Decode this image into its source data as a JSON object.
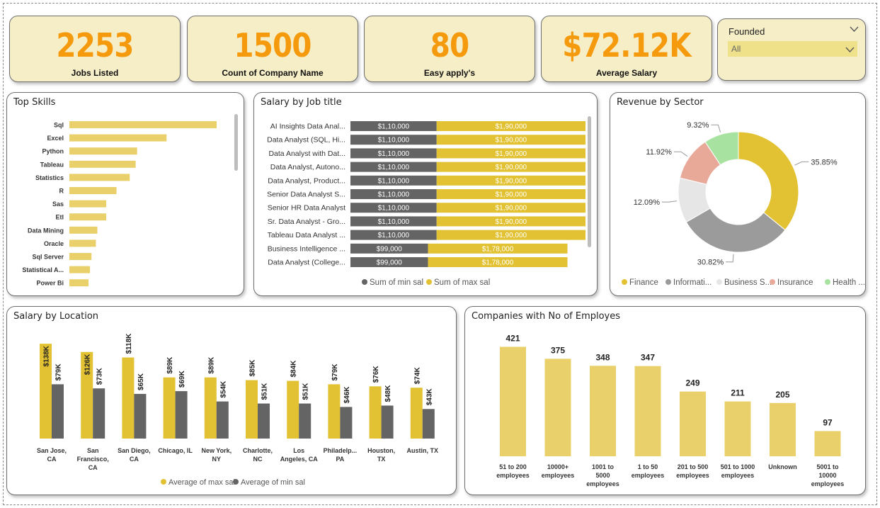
{
  "kpis": [
    {
      "value": "2253",
      "label": "Jobs Listed"
    },
    {
      "value": "1500",
      "label": "Count of Company Name"
    },
    {
      "value": "80",
      "label": "Easy apply's"
    },
    {
      "value": "$72.12K",
      "label": "Average Salary"
    }
  ],
  "slicer": {
    "title": "Founded",
    "selected": "All"
  },
  "colors": {
    "gold": "#e2c232",
    "gold_light": "#ead06a",
    "dark_grey": "#646464",
    "kpi_orange": "#f59a0c",
    "kpi_bg": "#f6eec7"
  },
  "top_skills": {
    "title": "Top Skills",
    "chart_data": {
      "type": "bar",
      "orientation": "horizontal",
      "categories": [
        "Sql",
        "Excel",
        "Python",
        "Tableau",
        "Statistics",
        "R",
        "Sas",
        "Etl",
        "Data Mining",
        "Oracle",
        "Sql Server",
        "Statistical A...",
        "Power Bi"
      ],
      "values": [
        100,
        66,
        46,
        45,
        41,
        32,
        25,
        25,
        19,
        18,
        15,
        14,
        13
      ],
      "xlim": [
        0,
        100
      ]
    }
  },
  "salary_by_job": {
    "title": "Salary by Job title",
    "chart_data": {
      "type": "bar",
      "orientation": "horizontal",
      "stacked": true,
      "categories": [
        "AI Insights Data Anal...",
        "Data Analyst (SQL, Hi...",
        "Data Analyst with Dat...",
        "Data Analyst, Autono...",
        "Data Analyst, Product...",
        "Senior Data Analyst S...",
        "Senior HR Data Analyst",
        "Sr. Data Analyst - Gro...",
        "Tableau Data Analyst ...",
        "Business Intelligence ...",
        "Data Analyst (College..."
      ],
      "series": [
        {
          "name": "Sum of min sal",
          "values": [
            110000,
            110000,
            110000,
            110000,
            110000,
            110000,
            110000,
            110000,
            110000,
            99000,
            99000
          ],
          "labels": [
            "$1,10,000",
            "$1,10,000",
            "$1,10,000",
            "$1,10,000",
            "$1,10,000",
            "$1,10,000",
            "$1,10,000",
            "$1,10,000",
            "$1,10,000",
            "$99,000",
            "$99,000"
          ]
        },
        {
          "name": "Sum of max sal",
          "values": [
            190000,
            190000,
            190000,
            190000,
            190000,
            190000,
            190000,
            190000,
            190000,
            178000,
            178000
          ],
          "labels": [
            "$1,90,000",
            "$1,90,000",
            "$1,90,000",
            "$1,90,000",
            "$1,90,000",
            "$1,90,000",
            "$1,90,000",
            "$1,90,000",
            "$1,90,000",
            "$1,78,000",
            "$1,78,000"
          ]
        }
      ]
    }
  },
  "revenue_by_sector": {
    "title": "Revenue by Sector",
    "chart_data": {
      "type": "pie",
      "donut": true,
      "categories": [
        "Finance",
        "Informati...",
        "Business S...",
        "Insurance",
        "Health ..."
      ],
      "values": [
        35.85,
        30.82,
        12.09,
        11.92,
        9.32
      ],
      "labels": [
        "35.85%",
        "30.82%",
        "12.09%",
        "11.92%",
        "9.32%"
      ],
      "colors": [
        "#e2c232",
        "#9b9b9b",
        "#e6e6e6",
        "#e8a999",
        "#a8e2a0"
      ]
    }
  },
  "salary_by_location": {
    "title": "Salary by Location",
    "chart_data": {
      "type": "bar",
      "categories": [
        "San Jose, CA",
        "San Francisco, CA",
        "San Diego, CA",
        "Chicago, IL",
        "New York, NY",
        "Charlotte, NC",
        "Los Angeles, CA",
        "Philadelp... PA",
        "Houston, TX",
        "Austin, TX"
      ],
      "category_lines": [
        [
          "San Jose,",
          "CA"
        ],
        [
          "San",
          "Francisco,",
          "CA"
        ],
        [
          "San Diego,",
          "CA"
        ],
        [
          "Chicago, IL"
        ],
        [
          "New York,",
          "NY"
        ],
        [
          "Charlotte,",
          "NC"
        ],
        [
          "Los",
          "Angeles, CA"
        ],
        [
          "Philadelp...",
          "PA"
        ],
        [
          "Houston,",
          "TX"
        ],
        [
          "Austin, TX"
        ]
      ],
      "series": [
        {
          "name": "Average of max sal",
          "values": [
            138,
            126,
            118,
            89,
            89,
            85,
            84,
            79,
            76,
            74
          ],
          "labels": [
            "$138K",
            "$126K",
            "$118K",
            "$89K",
            "$89K",
            "$85K",
            "$84K",
            "$79K",
            "$76K",
            "$74K"
          ]
        },
        {
          "name": "Average of min sal",
          "values": [
            79,
            73,
            65,
            69,
            54,
            51,
            51,
            46,
            48,
            43
          ],
          "labels": [
            "$79K",
            "$73K",
            "$65K",
            "$69K",
            "$54K",
            "$51K",
            "$51K",
            "$46K",
            "$48K",
            "$43K"
          ]
        }
      ],
      "unit": "K"
    }
  },
  "companies_employees": {
    "title": "Companies with No of Employes",
    "chart_data": {
      "type": "bar",
      "categories": [
        "51 to 200 employees",
        "10000+ employees",
        "1001 to 5000 employees",
        "1 to 50 employees",
        "201 to 500 employees",
        "501 to 1000 employees",
        "Unknown",
        "5001 to 10000 employees"
      ],
      "category_lines": [
        [
          "51 to 200",
          "employees"
        ],
        [
          "10000+",
          "employees"
        ],
        [
          "1001 to",
          "5000",
          "employees"
        ],
        [
          "1 to 50",
          "employees"
        ],
        [
          "201 to 500",
          "employees"
        ],
        [
          "501 to 1000",
          "employees"
        ],
        [
          "Unknown"
        ],
        [
          "5001 to",
          "10000",
          "employees"
        ]
      ],
      "values": [
        421,
        375,
        348,
        347,
        249,
        211,
        205,
        97
      ]
    }
  }
}
